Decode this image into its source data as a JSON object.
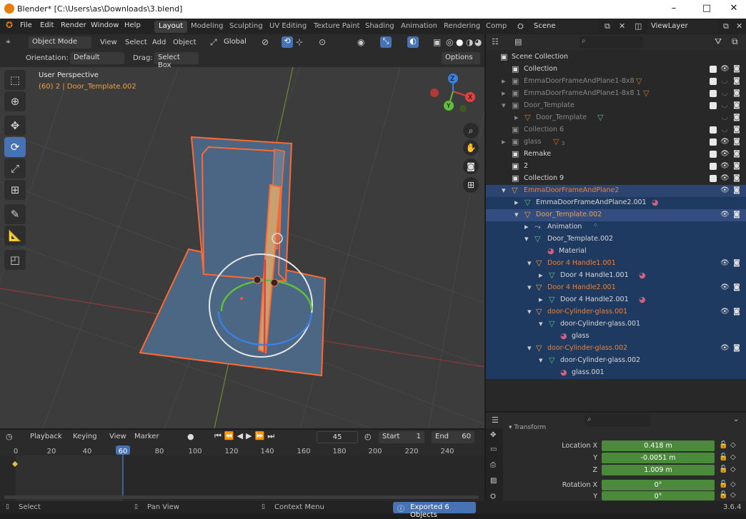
{
  "window": {
    "title": "Blender* [C:\\Users\\as\\Downloads\\3.blend]",
    "min": "–",
    "max": "□",
    "close": "✕"
  },
  "menu": {
    "items": [
      "File",
      "Edit",
      "Render",
      "Window",
      "Help"
    ]
  },
  "workspaces": [
    "Layout",
    "Modeling",
    "Sculpting",
    "UV Editing",
    "Texture Paint",
    "Shading",
    "Animation",
    "Rendering",
    "Comp"
  ],
  "scene": {
    "name": "Scene",
    "view_layer": "ViewLayer"
  },
  "viewport_header": {
    "mode": "Object Mode",
    "menus": [
      "View",
      "Select",
      "Add",
      "Object"
    ],
    "transform": "Global",
    "orientation_label": "Orientation:",
    "orientation_value": "Default",
    "drag_label": "Drag:",
    "drag_value": "Select Box",
    "options": "Options"
  },
  "viewport": {
    "perspective": "User Perspective",
    "object_info": "(60) 2 | Door_Template.002"
  },
  "gizmo": {
    "x": "X",
    "y": "Y",
    "z": "Z"
  },
  "timeline": {
    "menus": [
      "Playback",
      "Keying",
      "View",
      "Marker"
    ],
    "current_frame": "45",
    "start_label": "Start",
    "start": "1",
    "end_label": "End",
    "end": "60",
    "ticks": [
      "0",
      "20",
      "40",
      "60",
      "80",
      "100",
      "120",
      "140",
      "160",
      "180",
      "200",
      "220",
      "240"
    ],
    "playhead": "60"
  },
  "outliner": {
    "rows": [
      {
        "label": "Scene Collection"
      },
      {
        "label": "Collection"
      },
      {
        "label": "EmmaDoorFrameAndPlane1-8x8"
      },
      {
        "label": "EmmaDoorFrameAndPlane1-8x8 1"
      },
      {
        "label": "Door_Template"
      },
      {
        "label": "Door_Template"
      },
      {
        "label": "Collection 6"
      },
      {
        "label": "glass",
        "badge": "3"
      },
      {
        "label": "Remake"
      },
      {
        "label": "2"
      },
      {
        "label": "Collection 9"
      },
      {
        "label": "EmmaDoorFrameAndPlane2"
      },
      {
        "label": "EmmaDoorFrameAndPlane2.001"
      },
      {
        "label": "Door_Template.002"
      },
      {
        "label": "Animation"
      },
      {
        "label": "Door_Template.002"
      },
      {
        "label": "Material"
      },
      {
        "label": "Door  4 Handle1.001"
      },
      {
        "label": "Door  4 Handle1.001"
      },
      {
        "label": "Door  4 Handle2.001"
      },
      {
        "label": "Door  4 Handle2.001"
      },
      {
        "label": "door-Cylinder-glass.001"
      },
      {
        "label": "door-Cylinder-glass.001"
      },
      {
        "label": "glass"
      },
      {
        "label": "door-Cylinder-glass.002"
      },
      {
        "label": "door-Cylinder-glass.002"
      },
      {
        "label": "glass.001"
      }
    ]
  },
  "properties": {
    "section": "Transform",
    "location_x_label": "Location X",
    "location_x": "0.418 m",
    "y_label": "Y",
    "location_y": "-0.0051 m",
    "z_label": "Z",
    "location_z": "1.009 m",
    "rotation_x_label": "Rotation X",
    "rotation_x": "0°",
    "rot_y_label": "Y",
    "rotation_y": "0°"
  },
  "status": {
    "select": "Select",
    "pan": "Pan View",
    "context": "Context Menu",
    "message": "Exported 6 Objects",
    "version": "3.6.4"
  },
  "colors": {
    "accent": "#4772b3",
    "selected_orange": "#f0a040",
    "field_green": "#4a8a3a",
    "outline_orange": "#ff6a30"
  }
}
